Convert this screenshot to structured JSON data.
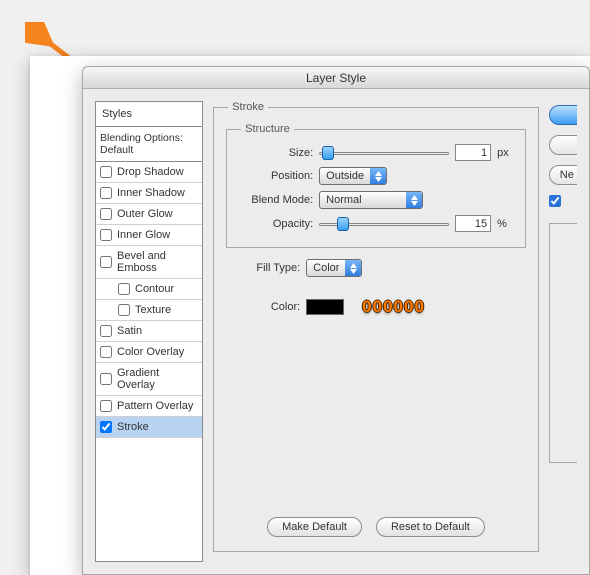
{
  "window": {
    "title": "Layer Style"
  },
  "sidebar": {
    "header": "Styles",
    "blending": "Blending Options: Default",
    "items": [
      {
        "label": "Drop Shadow",
        "checked": false,
        "indent": false
      },
      {
        "label": "Inner Shadow",
        "checked": false,
        "indent": false
      },
      {
        "label": "Outer Glow",
        "checked": false,
        "indent": false
      },
      {
        "label": "Inner Glow",
        "checked": false,
        "indent": false
      },
      {
        "label": "Bevel and Emboss",
        "checked": false,
        "indent": false
      },
      {
        "label": "Contour",
        "checked": false,
        "indent": true
      },
      {
        "label": "Texture",
        "checked": false,
        "indent": true
      },
      {
        "label": "Satin",
        "checked": false,
        "indent": false
      },
      {
        "label": "Color Overlay",
        "checked": false,
        "indent": false
      },
      {
        "label": "Gradient Overlay",
        "checked": false,
        "indent": false
      },
      {
        "label": "Pattern Overlay",
        "checked": false,
        "indent": false
      },
      {
        "label": "Stroke",
        "checked": true,
        "indent": false,
        "active": true
      }
    ]
  },
  "panel": {
    "stroke_title": "Stroke",
    "structure_title": "Structure",
    "size": {
      "label": "Size:",
      "value": "1",
      "unit": "px",
      "pos": 0.02
    },
    "position": {
      "label": "Position:",
      "value": "Outside"
    },
    "blendmode": {
      "label": "Blend Mode:",
      "value": "Normal"
    },
    "opacity": {
      "label": "Opacity:",
      "value": "15",
      "unit": "%",
      "pos": 0.15
    },
    "filltype": {
      "label": "Fill Type:",
      "value": "Color"
    },
    "color": {
      "label": "Color:",
      "swatch": "#000000",
      "hex_display": "000000"
    },
    "buttons": {
      "make_default": "Make Default",
      "reset": "Reset to Default"
    }
  },
  "right": {
    "ok": "",
    "cancel": "",
    "new": "Ne",
    "preview_checked": true
  }
}
